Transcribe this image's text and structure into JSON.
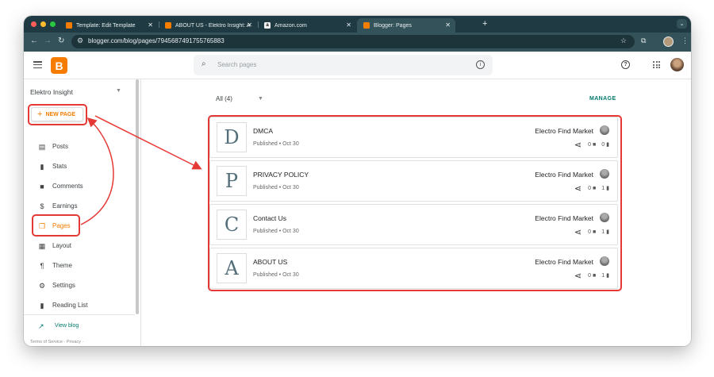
{
  "browser": {
    "tabs": [
      {
        "title": "Template: Edit Template",
        "favicon": "blogger-icon"
      },
      {
        "title": "ABOUT US - Elektro Insight: A",
        "favicon": "blogger-icon"
      },
      {
        "title": "Amazon.com",
        "favicon": "amazon-icon"
      },
      {
        "title": "Blogger: Pages",
        "favicon": "blogger-icon",
        "active": true
      }
    ],
    "url": "blogger.com/blog/pages/7945687491755765883"
  },
  "topbar": {
    "search_placeholder": "Search pages"
  },
  "sidebar": {
    "blog_name": "Elektro Insight",
    "new_page_label": "NEW PAGE",
    "items": [
      {
        "label": "Posts",
        "icon": "posts-icon"
      },
      {
        "label": "Stats",
        "icon": "stats-icon"
      },
      {
        "label": "Comments",
        "icon": "comments-icon"
      },
      {
        "label": "Earnings",
        "icon": "earnings-icon"
      },
      {
        "label": "Pages",
        "icon": "pages-icon",
        "active": true
      },
      {
        "label": "Layout",
        "icon": "layout-icon"
      },
      {
        "label": "Theme",
        "icon": "theme-icon"
      },
      {
        "label": "Settings",
        "icon": "settings-icon"
      },
      {
        "label": "Reading List",
        "icon": "reading-list-icon"
      }
    ],
    "view_blog_label": "View blog",
    "footer": "Terms of Service · Privacy ·"
  },
  "main": {
    "filter_label": "All (4)",
    "manage_label": "MANAGE",
    "pages": [
      {
        "letter": "D",
        "title": "DMCA",
        "status": "Published • Oct 30",
        "author": "Electro Find Market",
        "comments": "0",
        "views": "0"
      },
      {
        "letter": "P",
        "title": "PRIVACY POLICY",
        "status": "Published • Oct 30",
        "author": "Electro Find Market",
        "comments": "0",
        "views": "1"
      },
      {
        "letter": "C",
        "title": "Contact Us",
        "status": "Published • Oct 30",
        "author": "Electro Find Market",
        "comments": "0",
        "views": "1"
      },
      {
        "letter": "A",
        "title": "ABOUT US",
        "status": "Published • Oct 30",
        "author": "Electro Find Market",
        "comments": "0",
        "views": "1"
      }
    ]
  },
  "colors": {
    "accent": "#f57c00",
    "teal": "#00796b",
    "annotation": "#e53935"
  }
}
